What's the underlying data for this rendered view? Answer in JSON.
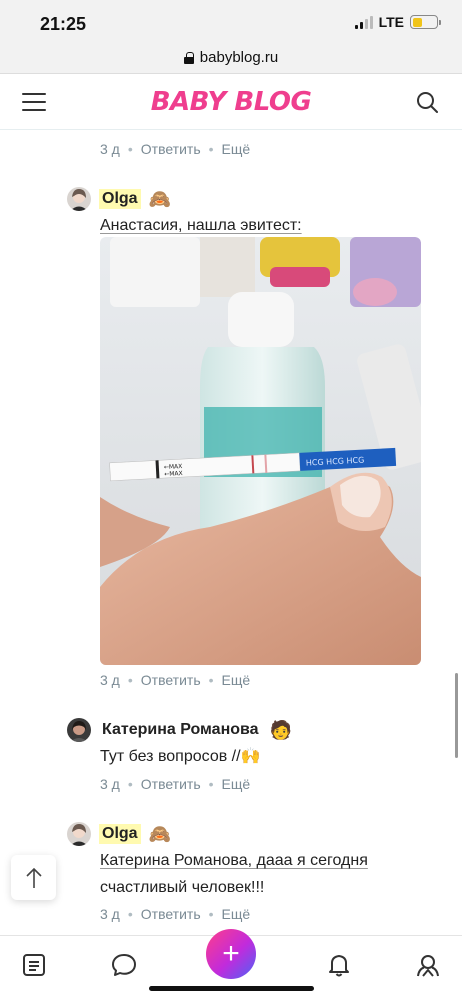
{
  "status_bar": {
    "time": "21:25",
    "network": "LTE"
  },
  "browser": {
    "url": "babyblog.ru"
  },
  "header": {
    "logo": "BABY BLOG"
  },
  "comments": [
    {
      "meta": {
        "time": "3 д",
        "reply": "Ответить",
        "more": "Ещё"
      }
    },
    {
      "author": "Olga",
      "author_emoji": "🙈",
      "text": "Анастасия, нашла эвитест:",
      "has_photo": true,
      "meta": {
        "time": "3 д",
        "reply": "Ответить",
        "more": "Ещё"
      }
    },
    {
      "author": "Катерина Романова",
      "author_emoji": "🧑",
      "text": "Тут без вопросов //🙌",
      "meta": {
        "time": "3 д",
        "reply": "Ответить",
        "more": "Ещё"
      }
    },
    {
      "author": "Olga",
      "author_emoji": "🙈",
      "text_line1": "Катерина Романова, дааа я сегодня",
      "text_line2": "счастливый человек!!!",
      "meta": {
        "time": "3 д",
        "reply": "Ответить",
        "more": "Ещё"
      }
    }
  ],
  "fab": {
    "label": "+"
  },
  "colors": {
    "brand": "#ef3e8e",
    "meta": "#7a8a94",
    "highlight": "#fffab0"
  },
  "icons": [
    "menu-icon",
    "search-icon",
    "feed-icon",
    "chat-icon",
    "bell-icon",
    "friends-icon",
    "arrow-up-icon",
    "lock-icon"
  ]
}
